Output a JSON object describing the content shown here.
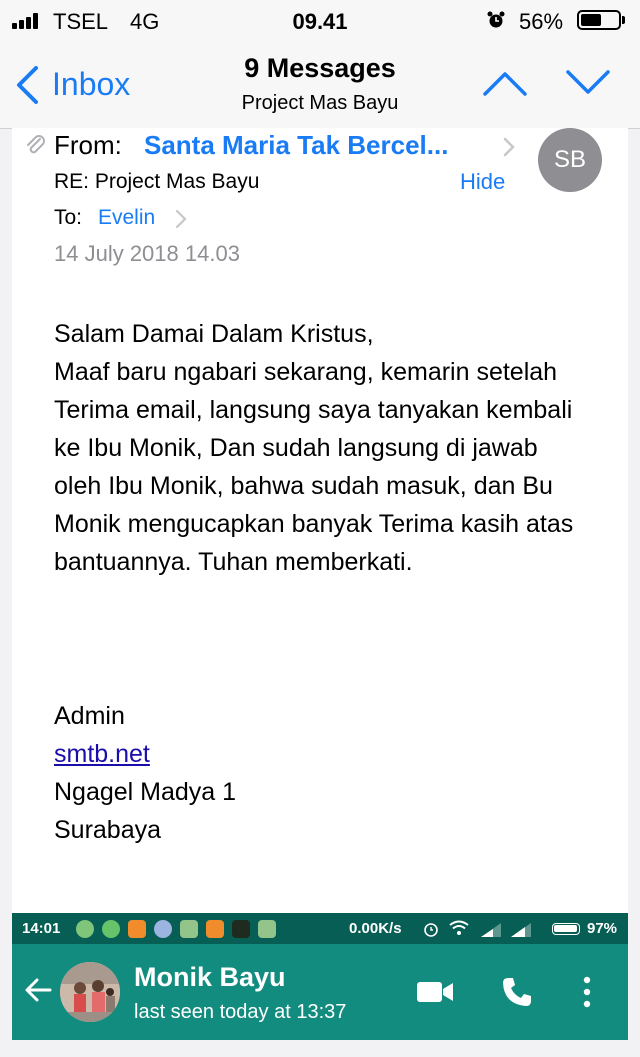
{
  "ios_status": {
    "carrier": "TSEL",
    "network": "4G",
    "time": "09.41",
    "battery_percent": "56%",
    "battery_level": 0.56
  },
  "navbar": {
    "back_label": "Inbox",
    "title": "9 Messages",
    "subtitle": "Project Mas Bayu"
  },
  "message": {
    "from_label": "From:",
    "from_name": "Santa Maria Tak Bercel...",
    "avatar_initials": "SB",
    "subject": "RE: Project Mas Bayu",
    "hide_label": "Hide",
    "to_label": "To:",
    "to_name": "Evelin",
    "date": "14 July 2018 14.03",
    "greeting": "Salam Damai Dalam Kristus,",
    "body": "Maaf baru ngabari sekarang, kemarin setelah Terima email, langsung saya tanyakan kembali ke Ibu Monik, Dan sudah langsung di jawab oleh Ibu Monik, bahwa sudah masuk, dan Bu Monik mengucapkan banyak Terima kasih atas bantuannya. Tuhan memberkati.",
    "signature": {
      "name": "Admin",
      "link": "smtb.net",
      "address1": "Ngagel Madya 1",
      "address2": "Surabaya"
    }
  },
  "android_status": {
    "time": "14:01",
    "speed": "0.00K/s",
    "battery_percent": "97%"
  },
  "whatsapp": {
    "contact_name": "Monik Bayu",
    "last_seen": "last seen today at 13:37"
  },
  "colors": {
    "ios_blue": "#1a7cf5",
    "whatsapp_dark": "#075e54",
    "whatsapp_teal": "#128c7e"
  }
}
